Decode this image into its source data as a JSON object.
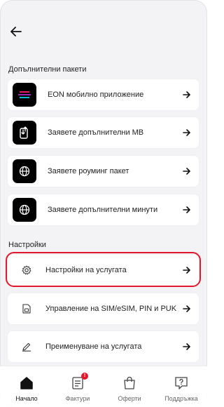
{
  "sections": {
    "packages_title": "Допълнителни пакети",
    "settings_title": "Настройки"
  },
  "packages": [
    {
      "label": "EON мобилно приложение",
      "icon": "eon-app-icon"
    },
    {
      "label": "Заявете допълнителни MB",
      "icon": "phone-data-icon"
    },
    {
      "label": "Заявете роуминг пакет",
      "icon": "globe-icon"
    },
    {
      "label": "Заявете допълнителни минути",
      "icon": "globe-icon"
    }
  ],
  "settings": [
    {
      "label": "Настройки на услугата",
      "icon": "gear-icon"
    },
    {
      "label": "Управление на SIM/eSIM, PIN и PUK",
      "icon": "sim-card-icon"
    },
    {
      "label": "Преименуване на услугата",
      "icon": "pencil-icon"
    }
  ],
  "nav": [
    {
      "label": "Начало",
      "icon": "home-icon",
      "active": true
    },
    {
      "label": "Фактури",
      "icon": "invoice-icon",
      "badge": "!"
    },
    {
      "label": "Оферти",
      "icon": "shopping-bag-icon"
    },
    {
      "label": "Поддръжка",
      "icon": "support-icon"
    }
  ],
  "colors": {
    "accent": "#e0182d",
    "background": "#f3f3f6",
    "card": "#ffffff",
    "text": "#222222"
  }
}
